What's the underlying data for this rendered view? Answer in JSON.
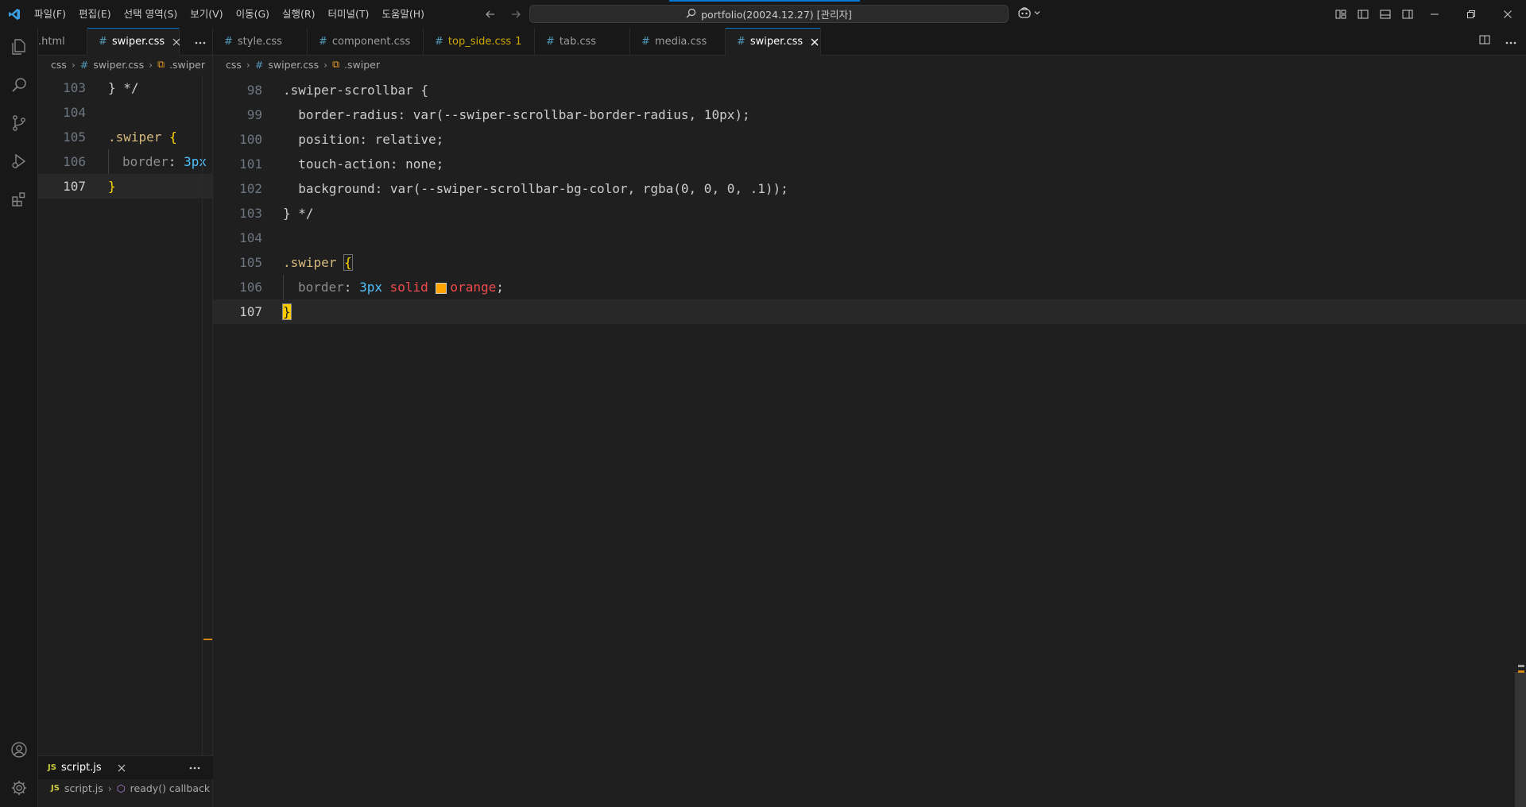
{
  "title_bar": {
    "menu": [
      "파일(F)",
      "편집(E)",
      "선택 영역(S)",
      "보기(V)",
      "이동(G)",
      "실행(R)",
      "터미널(T)",
      "도움말(H)"
    ],
    "command_center": "portfolio(20024.12.27) [관리자]"
  },
  "left_group": {
    "tabs": [
      {
        "label": ".html"
      },
      {
        "label": "swiper.css"
      }
    ],
    "breadcrumb": [
      "css",
      "swiper.css",
      ".swiper"
    ],
    "lines": [
      {
        "num": "103",
        "text": "} */"
      },
      {
        "num": "104",
        "text": ""
      },
      {
        "num": "105",
        "sel": ".swiper",
        "brace": "{"
      },
      {
        "num": "106",
        "prop": "border",
        "value": "3px"
      },
      {
        "num": "107",
        "brace": "}"
      }
    ],
    "bottom_tab": "script.js",
    "bottom_breadcrumb": [
      "script.js",
      "ready() callback"
    ]
  },
  "right_group": {
    "tabs": [
      {
        "label": "style.css"
      },
      {
        "label": "component.css"
      },
      {
        "label": "top_side.css",
        "badge": "1"
      },
      {
        "label": "tab.css"
      },
      {
        "label": "media.css"
      },
      {
        "label": "swiper.css"
      }
    ],
    "breadcrumb": [
      "css",
      "swiper.css",
      ".swiper"
    ],
    "lines": [
      {
        "num": "98",
        "text": ".swiper-scrollbar {"
      },
      {
        "num": "99",
        "text": "  border-radius: var(--swiper-scrollbar-border-radius, 10px);"
      },
      {
        "num": "100",
        "text": "  position: relative;"
      },
      {
        "num": "101",
        "text": "  touch-action: none;"
      },
      {
        "num": "102",
        "text": "  background: var(--swiper-scrollbar-bg-color, rgba(0, 0, 0, .1));"
      },
      {
        "num": "103",
        "text": "} */"
      },
      {
        "num": "104",
        "text": ""
      },
      {
        "num": "105",
        "sel": ".swiper",
        "brace": "{"
      },
      {
        "num": "106",
        "prop": "border",
        "num_val": "3px",
        "kw1": "solid",
        "color_name": "orange"
      },
      {
        "num": "107",
        "brace": "}"
      }
    ]
  },
  "colors": {
    "accent": "#0078d4",
    "swatch": "#ffa500",
    "selector": "#d7ba7d",
    "brace": "#ffd700"
  }
}
